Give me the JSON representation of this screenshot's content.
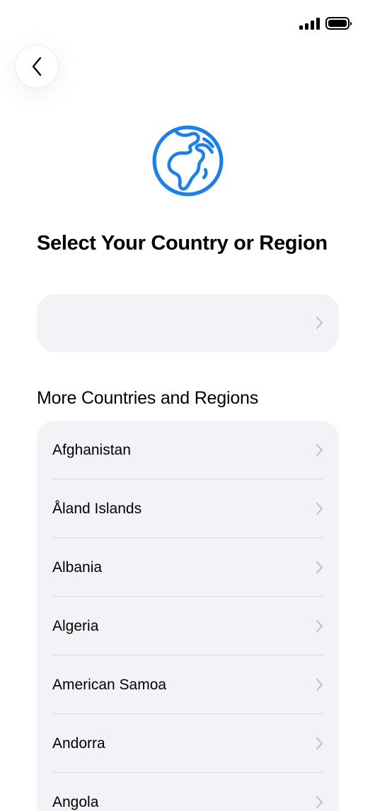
{
  "status_bar": {
    "signal_icon": "cellular-signal-icon",
    "battery_icon": "battery-full-icon"
  },
  "back_button": {
    "icon": "chevron-left-icon"
  },
  "header": {
    "icon": "globe-europe-africa-icon",
    "title": "Select Your Country or Region"
  },
  "current_selection": {
    "label": "",
    "icon": "chevron-right-icon"
  },
  "more_section": {
    "title": "More Countries and Regions",
    "countries": [
      {
        "label": "Afghanistan"
      },
      {
        "label": "Åland Islands"
      },
      {
        "label": "Albania"
      },
      {
        "label": "Algeria"
      },
      {
        "label": "American Samoa"
      },
      {
        "label": "Andorra"
      },
      {
        "label": "Angola"
      }
    ]
  },
  "colors": {
    "accent": "#1f7fe8",
    "row_background": "#f2f2f7",
    "chevron": "#c3c3c8",
    "divider": "#d8d8de"
  }
}
